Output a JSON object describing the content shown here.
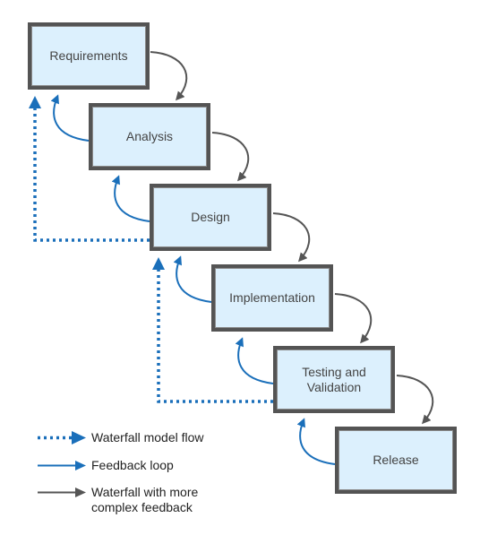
{
  "stages": [
    {
      "id": "requirements",
      "label": "Requirements"
    },
    {
      "id": "analysis",
      "label": "Analysis"
    },
    {
      "id": "design",
      "label": "Design"
    },
    {
      "id": "implementation",
      "label": "Implementation"
    },
    {
      "id": "testing",
      "label": "Testing and\nValidation"
    },
    {
      "id": "release",
      "label": "Release"
    }
  ],
  "legend": {
    "waterfall_flow": "Waterfall model flow",
    "feedback_loop": "Feedback loop",
    "complex_feedback": "Waterfall with more complex feedback"
  },
  "colors": {
    "box_fill": "#dcf0fd",
    "box_border": "#545454",
    "blue": "#1a6fba",
    "gray": "#555555"
  }
}
